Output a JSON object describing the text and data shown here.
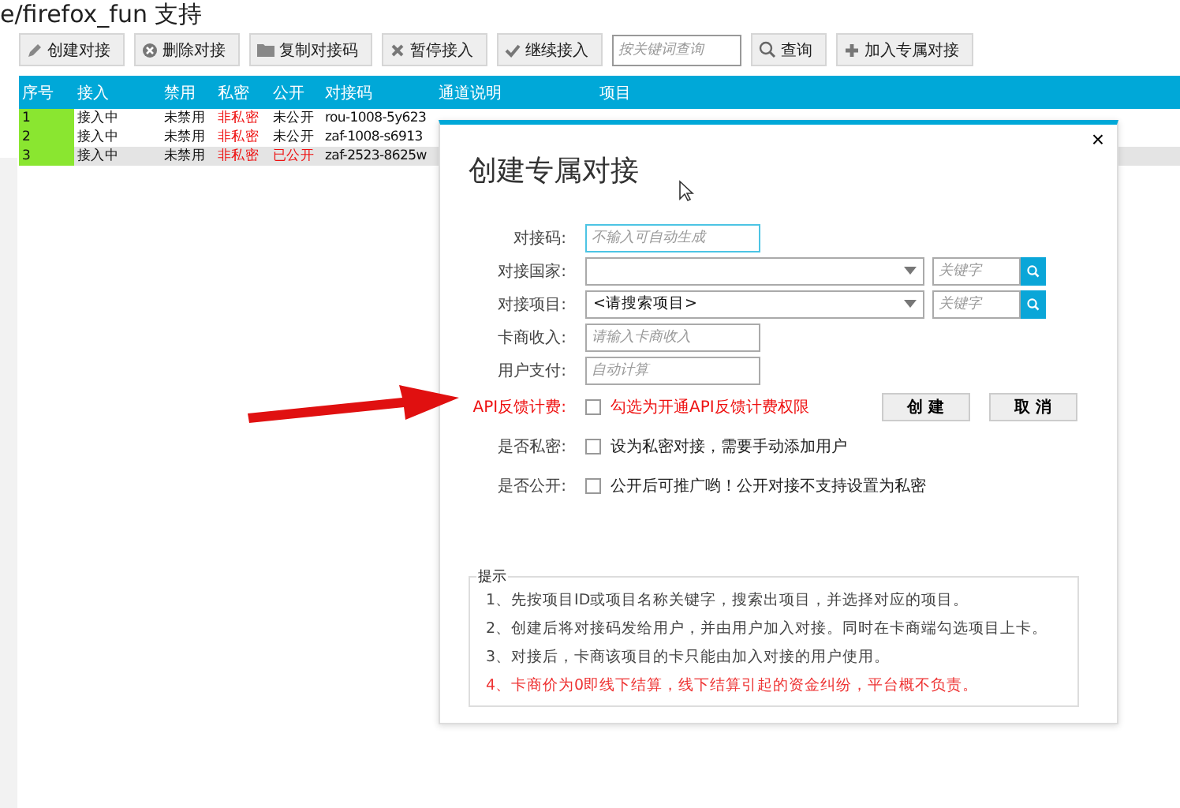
{
  "page_title": "e/firefox_fun 支持",
  "toolbar": [
    {
      "kind": "button",
      "label": "创建对接"
    },
    {
      "kind": "button",
      "label": "删除对接"
    },
    {
      "kind": "button",
      "label": "复制对接码"
    },
    {
      "kind": "button",
      "label": "暂停接入"
    },
    {
      "kind": "button",
      "label": "继续接入"
    },
    {
      "kind": "search",
      "placeholder": "按关键词查询"
    },
    {
      "kind": "button",
      "label": "查询"
    },
    {
      "kind": "button",
      "label": "加入专属对接"
    }
  ],
  "table": {
    "columns": [
      "序号",
      "接入",
      "禁用",
      "私密",
      "公开",
      "对接码",
      "通道说明",
      "项目"
    ],
    "rows": [
      {
        "selected": false,
        "cells": [
          {
            "kind": "seq",
            "text": "1"
          },
          {
            "kind": "plain",
            "text": "接入中"
          },
          {
            "kind": "plain",
            "text": "未禁用"
          },
          {
            "kind": "alert",
            "text": "非私密"
          },
          {
            "kind": "plain",
            "text": "未公开"
          },
          {
            "kind": "plain",
            "text": "rou-1008-5y623"
          }
        ]
      },
      {
        "selected": false,
        "cells": [
          {
            "kind": "seq",
            "text": "2"
          },
          {
            "kind": "plain",
            "text": "接入中"
          },
          {
            "kind": "plain",
            "text": "未禁用"
          },
          {
            "kind": "alert",
            "text": "非私密"
          },
          {
            "kind": "plain",
            "text": "未公开"
          },
          {
            "kind": "plain",
            "text": "zaf-1008-s6913"
          }
        ]
      },
      {
        "selected": true,
        "cells": [
          {
            "kind": "seq",
            "text": "3"
          },
          {
            "kind": "plain",
            "text": "接入中"
          },
          {
            "kind": "plain",
            "text": "未禁用"
          },
          {
            "kind": "alert",
            "text": "非私密"
          },
          {
            "kind": "alert",
            "text": "已公开"
          },
          {
            "kind": "plain",
            "text": "zaf-2523-8625w"
          }
        ]
      }
    ]
  },
  "dialog": {
    "title": "创建专属对接",
    "close": "×",
    "fields": [
      {
        "kind": "input",
        "label": "对接码:",
        "placeholder": "不输入可自动生成",
        "focused": true
      },
      {
        "kind": "select",
        "label": "对接国家:",
        "search_placeholder": "关键字"
      },
      {
        "kind": "select",
        "label": "对接项目:",
        "value": "<请搜索项目>",
        "search_placeholder": "关键字"
      },
      {
        "kind": "input",
        "label": "卡商收入:",
        "placeholder": "请输入卡商收入",
        "focused": false
      },
      {
        "kind": "input",
        "label": "用户支付:",
        "placeholder": "自动计算",
        "focused": false
      }
    ],
    "checks": [
      {
        "kind": "alert",
        "label": "API反馈计费:",
        "text": "勾选为开通API反馈计费权限",
        "checked": false
      },
      {
        "kind": "plain",
        "label": "是否私密:",
        "text": "设为私密对接，需要手动添加用户",
        "checked": false
      },
      {
        "kind": "plain",
        "label": "是否公开:",
        "text": "公开后可推广哟！公开对接不支持设置为私密",
        "checked": false
      }
    ],
    "buttons": [
      "创 建",
      "取 消"
    ],
    "hint": {
      "title": "提示",
      "lines": [
        {
          "kind": "plain",
          "text": "1、先按项目ID或项目名称关键字，搜索出项目，并选择对应的项目。"
        },
        {
          "kind": "plain",
          "text": "2、创建后将对接码发给用户，并由用户加入对接。同时在卡商端勾选项目上卡。"
        },
        {
          "kind": "plain",
          "text": "3、对接后，卡商该项目的卡只能由加入对接的用户使用。"
        },
        {
          "kind": "alert",
          "text": "4、卡商价为0即线下结算，线下结算引起的资金纠纷，平台概不负责。"
        }
      ]
    }
  }
}
